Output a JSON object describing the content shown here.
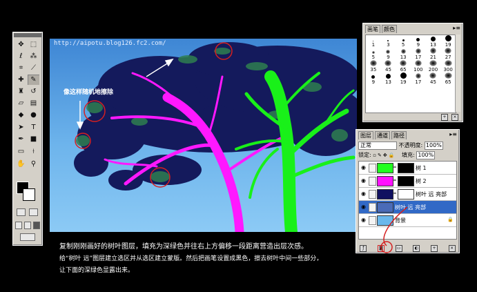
{
  "watermark": "http://aipotu.blog126.fc2.com/",
  "annotation": "像这样随机地擦除",
  "toolbox": {
    "tools": [
      "move-tool",
      "marquee-tool",
      "lasso-tool",
      "magic-wand-tool",
      "crop-tool",
      "slice-tool",
      "healing-brush-tool",
      "brush-tool",
      "clone-stamp-tool",
      "history-brush-tool",
      "eraser-tool",
      "gradient-tool",
      "blur-tool",
      "dodge-tool",
      "path-selection-tool",
      "type-tool",
      "pen-tool",
      "shape-tool",
      "notes-tool",
      "eyedropper-tool",
      "hand-tool",
      "zoom-tool"
    ]
  },
  "brushes_panel": {
    "tabs": [
      "画笔",
      "颜色"
    ],
    "menu_icon": "panel-menu-icon",
    "sizes": [
      "1",
      "3",
      "5",
      "9",
      "13",
      "19",
      "5",
      "9",
      "13",
      "17",
      "21",
      "27",
      "35",
      "45",
      "65",
      "100",
      "200",
      "300",
      "9",
      "13",
      "19",
      "17",
      "45",
      "65"
    ]
  },
  "layers_panel": {
    "tabs": [
      "图层",
      "通道",
      "路径"
    ],
    "blend_mode": "正常",
    "opacity_label": "不透明度:",
    "opacity_value": "100%",
    "lock_label": "锁定:",
    "fill_label": "填充:",
    "fill_value": "100%",
    "layers": [
      {
        "name": "树 1",
        "thumb_color": "#20ff20",
        "selected": false
      },
      {
        "name": "树 2",
        "thumb_color": "#ff10ff",
        "selected": false
      },
      {
        "name": "树叶 远 亮部",
        "thumb_color": "#101060",
        "selected": false
      },
      {
        "name": "树叶 远 亮部",
        "thumb_color": "#4a6bb8",
        "selected": true
      },
      {
        "name": "背景",
        "thumb_color": "#6ab8ec",
        "selected": false
      }
    ]
  },
  "caption": {
    "line1": "复制刚刚画好的树叶图层，填充为深绿色并往右上方偏移一段距离营造出层次感。",
    "line2": "给“树叶 远”图层建立选区并从选区建立蒙版。然后把画笔设置成黑色，擦去树叶中间一些部分，",
    "line3": "让下面的深绿色显露出来。"
  },
  "colors": {
    "tree_green": "#19f019",
    "tree_magenta": "#ff18ff",
    "foliage_dark": "#141a5c",
    "foliage_green": "#2e7e50",
    "sky": "#5aa8e6",
    "circle": "#d42020",
    "selection": "#3169c6"
  }
}
